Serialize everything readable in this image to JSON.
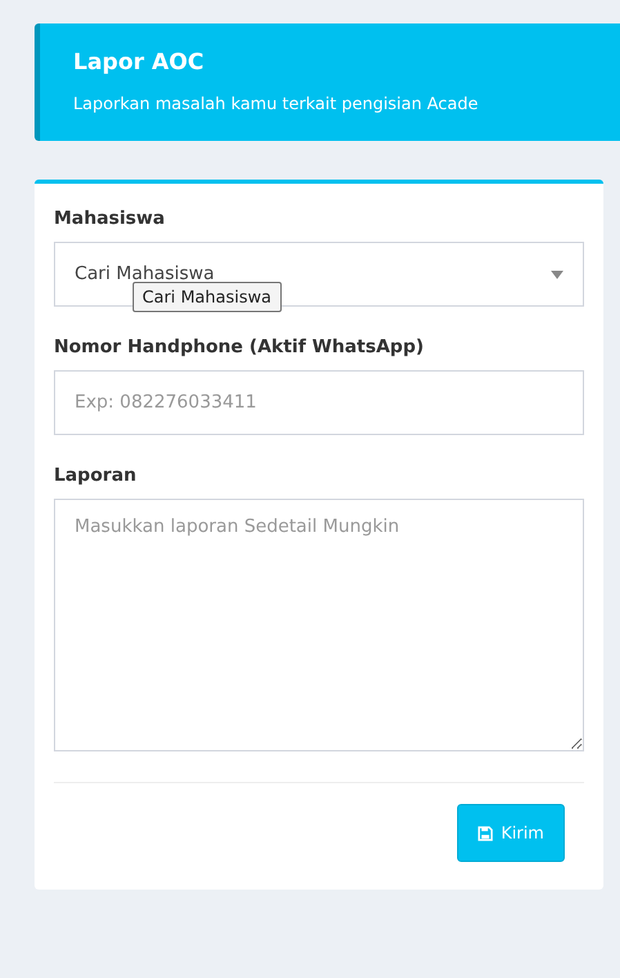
{
  "header": {
    "title": "Lapor AOC",
    "subtitle": "Laporkan masalah kamu terkait pengisian Acade"
  },
  "form": {
    "fields": [
      {
        "kind": "select",
        "label": "Mahasiswa",
        "value": "Cari Mahasiswa",
        "tooltip": "Cari Mahasiswa"
      },
      {
        "kind": "input",
        "label": "Nomor Handphone (Aktif WhatsApp)",
        "placeholder": "Exp: 082276033411"
      },
      {
        "kind": "textarea",
        "label": "Laporan",
        "placeholder": "Masukkan laporan Sedetail Mungkin"
      }
    ],
    "submit": "Kirim"
  }
}
